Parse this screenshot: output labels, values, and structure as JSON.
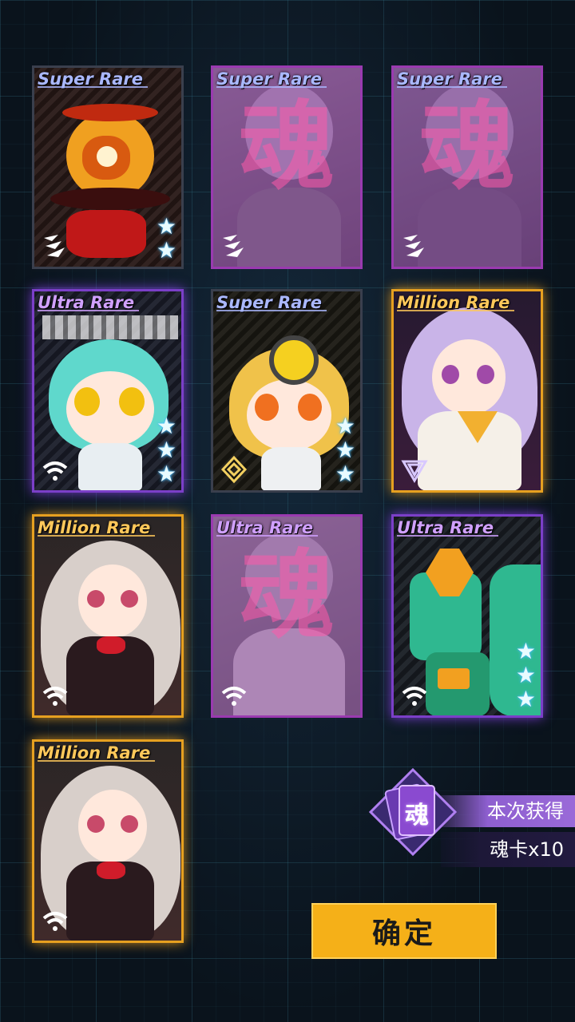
{
  "cards": [
    {
      "rarity": "Super Rare",
      "tier": "sr",
      "soul": false,
      "stars": 2,
      "element": "stripes-icon"
    },
    {
      "rarity": "Super Rare",
      "tier": "soul",
      "soul": true,
      "soul_char": "魂",
      "element": "stripes-icon"
    },
    {
      "rarity": "Super Rare",
      "tier": "soul",
      "soul": true,
      "soul_char": "魂",
      "element": "stripes-icon"
    },
    {
      "rarity": "Ultra Rare",
      "tier": "ur",
      "soul": false,
      "stars": 3,
      "element": "wifi-icon"
    },
    {
      "rarity": "Super Rare",
      "tier": "sr",
      "soul": false,
      "stars": 3,
      "element": "diamond-icon"
    },
    {
      "rarity": "Million Rare",
      "tier": "mr",
      "soul": false,
      "stars": 0,
      "element": "triangle-icon"
    },
    {
      "rarity": "Million Rare",
      "tier": "mr",
      "soul": false,
      "stars": 0,
      "element": "wifi-icon"
    },
    {
      "rarity": "Ultra Rare",
      "tier": "soul",
      "soul": true,
      "soul_char": "魂",
      "element": "wifi-icon"
    },
    {
      "rarity": "Ultra Rare",
      "tier": "ur",
      "soul": false,
      "stars": 3,
      "element": "wifi-icon"
    },
    {
      "rarity": "Million Rare",
      "tier": "mr",
      "soul": false,
      "stars": 0,
      "element": "wifi-icon"
    }
  ],
  "soul_summary": {
    "icon_char": "魂",
    "obtained_label": "本次获得",
    "obtained_value": "魂卡x10"
  },
  "confirm_button": {
    "label": "确定"
  },
  "colors": {
    "ur_glow": "#9646ff",
    "mr_glow": "#ffaa1e",
    "button": "#f5b018"
  }
}
